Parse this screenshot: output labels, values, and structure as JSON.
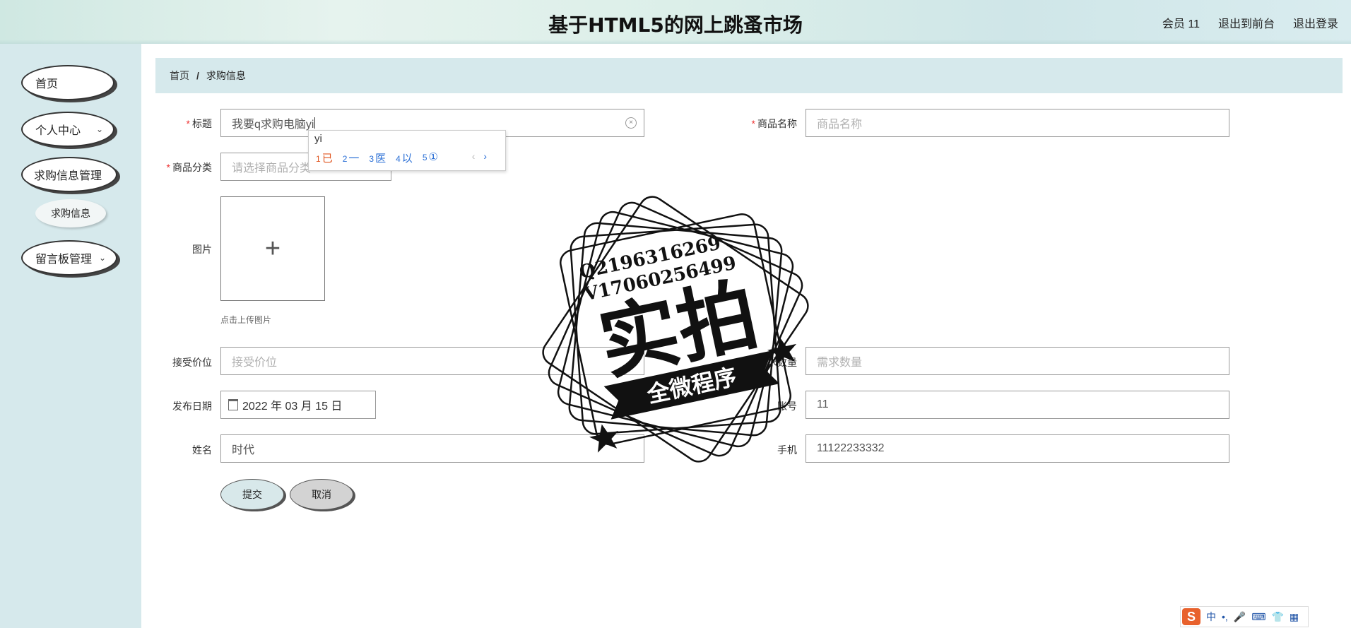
{
  "header": {
    "title": "基于HTML5的网上跳蚤市场",
    "links": [
      "会员 11",
      "退出到前台",
      "退出登录"
    ]
  },
  "sidebar": {
    "items": [
      {
        "label": "首页"
      },
      {
        "label": "个人中心"
      },
      {
        "label": "求购信息管理"
      },
      {
        "label": "求购信息"
      },
      {
        "label": "留言板管理"
      }
    ]
  },
  "breadcrumb": {
    "home": "首页",
    "separator": "/",
    "current": "求购信息"
  },
  "form": {
    "title": {
      "label": "标题",
      "value": "我要q求购电脑yi"
    },
    "product_name": {
      "label": "商品名称",
      "placeholder": "商品名称"
    },
    "category": {
      "label": "商品分类",
      "placeholder": "请选择商品分类"
    },
    "image": {
      "label": "图片",
      "hint": "点击上传图片"
    },
    "price": {
      "label": "接受价位",
      "placeholder": "接受价位"
    },
    "quantity": {
      "label": "需求数量",
      "placeholder": "需求数量"
    },
    "publish_date": {
      "label": "发布日期",
      "value": "2022 年 03 月 15 日"
    },
    "account": {
      "label": "账号",
      "value": "11"
    },
    "name": {
      "label": "姓名",
      "value": "时代"
    },
    "phone": {
      "label": "手机",
      "value": "11122233332"
    },
    "submit_label": "提交",
    "cancel_label": "取消"
  },
  "ime_popup": {
    "composition": "yi",
    "candidates": [
      {
        "index": "1",
        "text": "已"
      },
      {
        "index": "2",
        "text": "一"
      },
      {
        "index": "3",
        "text": "医"
      },
      {
        "index": "4",
        "text": "以"
      },
      {
        "index": "5",
        "text": "①"
      }
    ],
    "prev": "‹",
    "next": "›"
  },
  "watermark": {
    "line1": "Q2196316269",
    "line2": "V17060256499",
    "main": "实拍",
    "banner": "全微程序"
  },
  "ime_toolbar": {
    "logo": "S",
    "mode": "中",
    "punct": "•,",
    "icons": [
      "mic-icon",
      "keyboard-icon",
      "skin-icon",
      "grid-icon"
    ]
  },
  "colors": {
    "sidebar_bg": "#d6e9ec",
    "breadcrumb_bg": "#d6e9ec",
    "required_star": "#ee3333",
    "ime_first_candidate": "#e0551f",
    "ime_candidate": "#2a6fd6",
    "sogou_logo": "#e8612c"
  }
}
